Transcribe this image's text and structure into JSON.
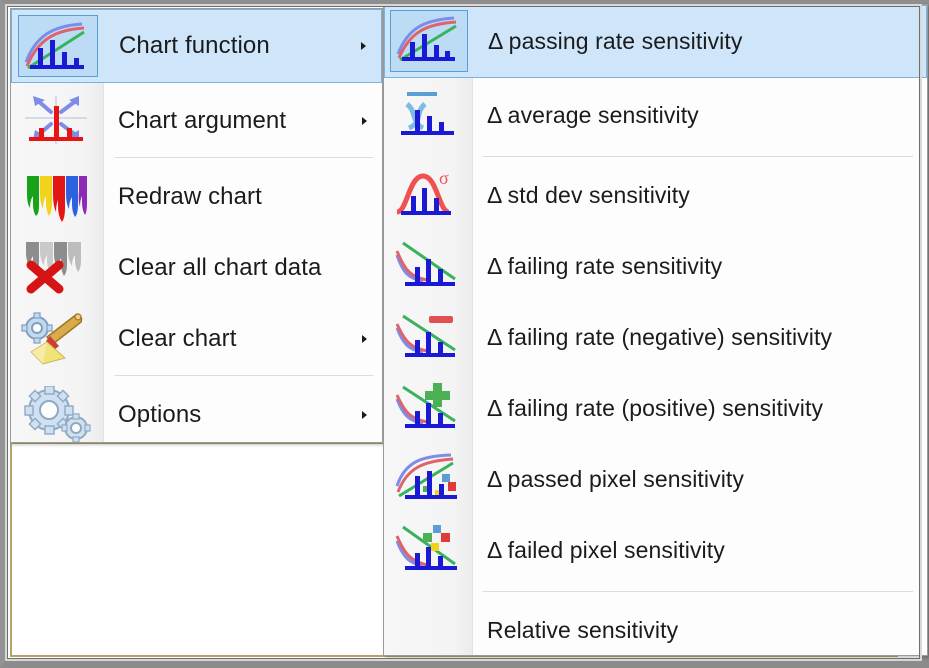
{
  "window": {
    "frame_color": "#8b8b8b",
    "client_border_color": "#b4a46a",
    "background": "#ffffff"
  },
  "colors": {
    "highlight_fill": "#cfe6fa",
    "highlight_border": "#7ab2e0",
    "menu_background": "#fdfdfd",
    "gutter_background": "#f4f4f4",
    "separator": "#dcdcdc",
    "text": "#1b1b1b"
  },
  "main_menu": {
    "name": "chart-context-menu",
    "items": [
      {
        "label": "Chart function",
        "icon": "chart-function-icon",
        "submenu": true,
        "selected": true,
        "separator_after": false
      },
      {
        "label": "Chart argument",
        "icon": "chart-argument-icon",
        "submenu": true,
        "selected": false,
        "separator_after": true
      },
      {
        "label": "Redraw chart",
        "icon": "redraw-chart-icon",
        "submenu": false,
        "selected": false,
        "separator_after": false
      },
      {
        "label": "Clear all chart data",
        "icon": "clear-all-data-icon",
        "submenu": false,
        "selected": false,
        "separator_after": false
      },
      {
        "label": "Clear chart",
        "icon": "clear-chart-icon",
        "submenu": true,
        "selected": false,
        "separator_after": true
      },
      {
        "label": "Options",
        "icon": "options-gears-icon",
        "submenu": true,
        "selected": false,
        "separator_after": false
      }
    ]
  },
  "sub_menu": {
    "name": "chart-function-submenu",
    "items": [
      {
        "label": "Δ passing rate sensitivity",
        "icon": "passing-rate-sensitivity-icon",
        "selected": true,
        "separator_after": false
      },
      {
        "label": "Δ average sensitivity",
        "icon": "average-sensitivity-icon",
        "selected": false,
        "separator_after": true
      },
      {
        "label": "Δ std dev sensitivity",
        "icon": "std-dev-sensitivity-icon",
        "selected": false,
        "separator_after": false
      },
      {
        "label": "Δ failing rate sensitivity",
        "icon": "failing-rate-sensitivity-icon",
        "selected": false,
        "separator_after": false
      },
      {
        "label": "Δ failing rate (negative) sensitivity",
        "icon": "failing-rate-negative-sensitivity-icon",
        "selected": false,
        "separator_after": false
      },
      {
        "label": "Δ failing rate (positive) sensitivity",
        "icon": "failing-rate-positive-sensitivity-icon",
        "selected": false,
        "separator_after": false
      },
      {
        "label": "Δ passed pixel sensitivity",
        "icon": "passed-pixel-sensitivity-icon",
        "selected": false,
        "separator_after": false
      },
      {
        "label": "Δ failed pixel sensitivity",
        "icon": "failed-pixel-sensitivity-icon",
        "selected": false,
        "separator_after": true
      },
      {
        "label": "Relative sensitivity",
        "icon": "none",
        "selected": false,
        "separator_after": false
      }
    ]
  }
}
